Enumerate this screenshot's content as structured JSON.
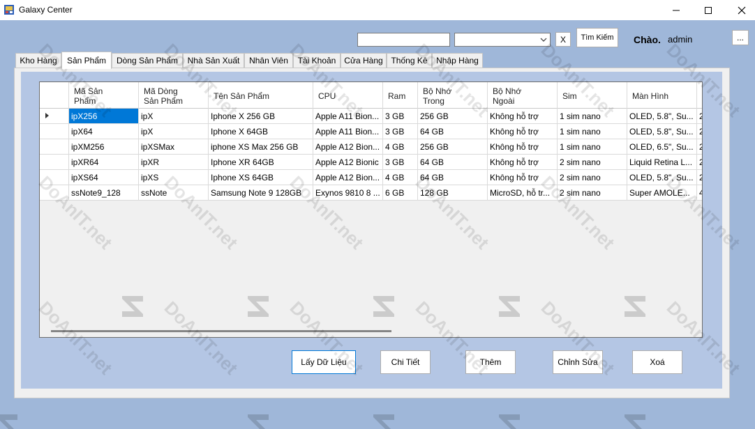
{
  "window": {
    "title": "Galaxy Center"
  },
  "search": {
    "input_value": "",
    "select_value": "",
    "clear_label": "X",
    "button_label": "Tìm Kiếm"
  },
  "user": {
    "greeting": "Chào.",
    "name": "admin",
    "more_label": "..."
  },
  "tabs": [
    {
      "label": "Kho Hàng",
      "active": false
    },
    {
      "label": "Sản Phẩm",
      "active": true
    },
    {
      "label": "Dòng Sản Phẩm",
      "active": false
    },
    {
      "label": "Nhà Sản Xuất",
      "active": false
    },
    {
      "label": "Nhân Viên",
      "active": false
    },
    {
      "label": "Tài Khoản",
      "active": false
    },
    {
      "label": "Cửa Hàng",
      "active": false
    },
    {
      "label": "Thống Kê",
      "active": false
    },
    {
      "label": "Nhập Hàng",
      "active": false
    }
  ],
  "table": {
    "columns": [
      {
        "line1": "Mã Sản",
        "line2": "Phẩm"
      },
      {
        "line1": "Mã Dòng",
        "line2": "Sản Phẩm"
      },
      {
        "line1": "Tên Sản Phẩm",
        "line2": ""
      },
      {
        "line1": "CPU",
        "line2": ""
      },
      {
        "line1": "Ram",
        "line2": ""
      },
      {
        "line1": "Bộ Nhớ",
        "line2": "Trong"
      },
      {
        "line1": "Bộ Nhớ",
        "line2": "Ngoài"
      },
      {
        "line1": "Sim",
        "line2": ""
      },
      {
        "line1": "Màn Hình",
        "line2": ""
      }
    ],
    "rows": [
      [
        "ipX256",
        "ipX",
        "Iphone X 256 GB",
        "Apple A11 Bion...",
        "3 GB",
        "256 GB",
        "Không hỗ trợ",
        "1 sim nano",
        "OLED, 5.8\", Su...",
        "2"
      ],
      [
        "ipX64",
        "ipX",
        "Iphone X 64GB",
        "Apple A11 Bion...",
        "3 GB",
        "64 GB",
        "Không hỗ trợ",
        "1 sim nano",
        "OLED, 5.8\", Su...",
        "2"
      ],
      [
        "ipXM256",
        "ipXSMax",
        "iphone XS Max 256 GB",
        "Apple A12 Bion...",
        "4 GB",
        "256 GB",
        "Không hỗ trợ",
        "1 sim nano",
        "OLED, 6.5\", Su...",
        "2"
      ],
      [
        "ipXR64",
        "ipXR",
        "Iphone XR 64GB",
        "Apple A12 Bionic",
        "3 GB",
        "64 GB",
        "Không hỗ trợ",
        "2 sim nano",
        "Liquid Retina L...",
        "2"
      ],
      [
        "ipXS64",
        "ipXS",
        "Iphone XS 64GB",
        "Apple A12 Bion...",
        "4 GB",
        "64 GB",
        "Không hỗ trợ",
        "2 sim nano",
        "OLED, 5.8\", Su...",
        "2"
      ],
      [
        "ssNote9_128",
        "ssNote",
        "Samsung Note 9 128GB",
        "Exynos 9810 8 ...",
        "6 GB",
        "128 GB",
        "MicroSD, hỗ tr...",
        "2 sim nano",
        "Super AMOLE...",
        "4"
      ]
    ],
    "selected_row": 0
  },
  "actions": {
    "load": "Lấy Dữ Liệu",
    "detail": "Chi Tiết",
    "add": "Thêm",
    "edit": "Chỉnh Sửa",
    "delete": "Xoá"
  },
  "watermark": {
    "text": "DoAnIT.net"
  }
}
